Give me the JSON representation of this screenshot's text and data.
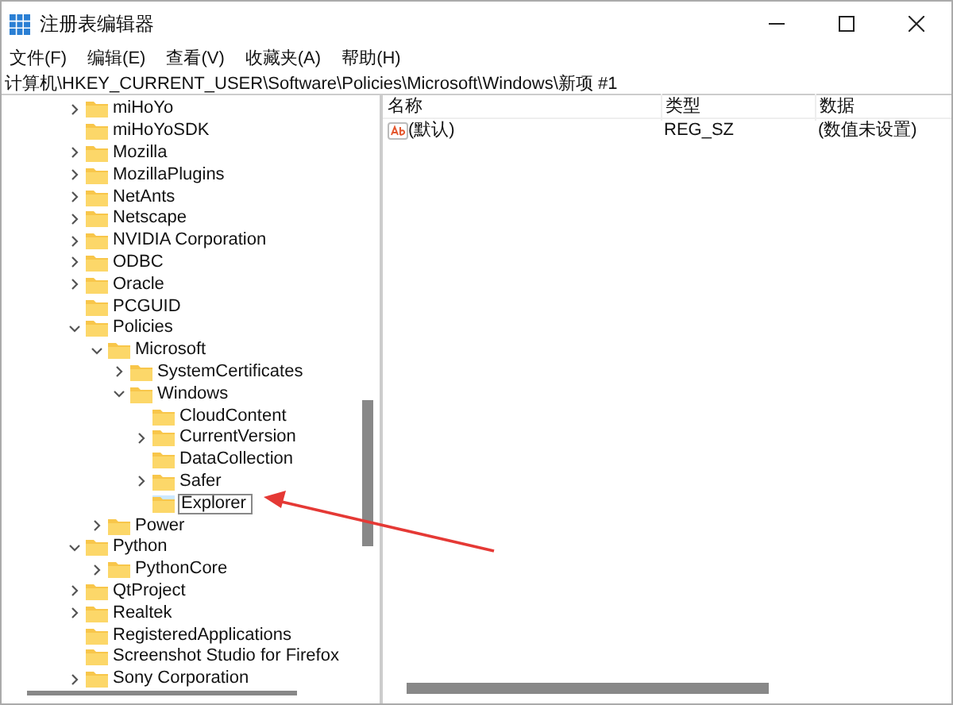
{
  "window": {
    "title": "注册表编辑器"
  },
  "menu": [
    "文件(F)",
    "编辑(E)",
    "查看(V)",
    "收藏夹(A)",
    "帮助(H)"
  ],
  "address": "计算机\\HKEY_CURRENT_USER\\Software\\Policies\\Microsoft\\Windows\\新项 #1",
  "tree": [
    {
      "label": "miHoYo",
      "kind": "branch",
      "expanded": false,
      "selected": false
    },
    {
      "label": "miHoYoSDK",
      "kind": "leaf",
      "selected": false
    },
    {
      "label": "Mozilla",
      "kind": "branch",
      "expanded": false,
      "selected": false
    },
    {
      "label": "MozillaPlugins",
      "kind": "branch",
      "expanded": false,
      "selected": false
    },
    {
      "label": "NetAnts",
      "kind": "branch",
      "expanded": false,
      "selected": false
    },
    {
      "label": "Netscape",
      "kind": "branch",
      "expanded": false,
      "selected": false
    },
    {
      "label": "NVIDIA Corporation",
      "kind": "branch",
      "expanded": false,
      "selected": false
    },
    {
      "label": "ODBC",
      "kind": "branch",
      "expanded": false,
      "selected": false
    },
    {
      "label": "Oracle",
      "kind": "branch",
      "expanded": false,
      "selected": false
    },
    {
      "label": "PCGUID",
      "kind": "leaf",
      "selected": false
    },
    {
      "label": "Policies",
      "kind": "branch",
      "expanded": true,
      "selected": false,
      "children": [
        {
          "label": "Microsoft",
          "kind": "branch",
          "expanded": true,
          "selected": false,
          "children": [
            {
              "label": "SystemCertificates",
              "kind": "branch",
              "expanded": false,
              "selected": false
            },
            {
              "label": "Windows",
              "kind": "branch",
              "expanded": true,
              "selected": false,
              "children": [
                {
                  "label": "CloudContent",
                  "kind": "leaf",
                  "selected": false
                },
                {
                  "label": "CurrentVersion",
                  "kind": "branch",
                  "expanded": false,
                  "selected": false
                },
                {
                  "label": "DataCollection",
                  "kind": "leaf",
                  "selected": false
                },
                {
                  "label": "Safer",
                  "kind": "branch",
                  "expanded": false,
                  "selected": false
                },
                {
                  "label": "Explorer",
                  "kind": "leaf",
                  "selected": true
                }
              ]
            }
          ]
        },
        {
          "label": "Power",
          "kind": "branch",
          "expanded": false,
          "selected": false
        }
      ]
    },
    {
      "label": "Python",
      "kind": "branch",
      "expanded": true,
      "selected": false,
      "children": [
        {
          "label": "PythonCore",
          "kind": "branch",
          "expanded": false,
          "selected": false
        }
      ]
    },
    {
      "label": "QtProject",
      "kind": "branch",
      "expanded": false,
      "selected": false
    },
    {
      "label": "Realtek",
      "kind": "branch",
      "expanded": false,
      "selected": false
    },
    {
      "label": "RegisteredApplications",
      "kind": "leaf",
      "selected": false
    },
    {
      "label": "Screenshot Studio for Firefox",
      "kind": "leaf",
      "selected": false
    },
    {
      "label": "Sony Corporation",
      "kind": "branch",
      "expanded": false,
      "selected": false
    }
  ],
  "values": {
    "columns": [
      "名称",
      "类型",
      "数据"
    ],
    "rows": [
      {
        "name": "(默认)",
        "type": "REG_SZ",
        "data": "(数值未设置)"
      }
    ]
  }
}
